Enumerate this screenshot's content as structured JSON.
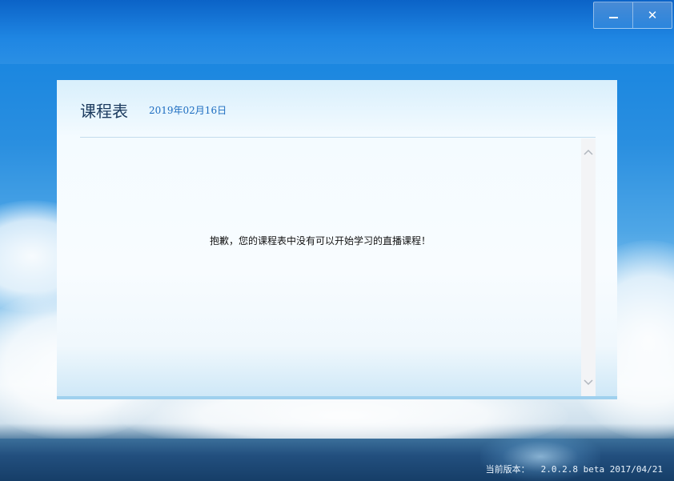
{
  "window": {
    "minimize_label": "–",
    "close_label": "✕"
  },
  "schedule": {
    "title": "课程表",
    "date": "2019年02月16日",
    "empty_message": "抱歉，您的课程表中没有可以开始学习的直播课程！"
  },
  "footer": {
    "version_label": "当前版本：",
    "version_value": "2.0.2.8 beta 2017/04/21"
  },
  "icons": {
    "minimize": "minimize-icon",
    "close": "close-icon",
    "scroll_up": "chevron-up-icon",
    "scroll_down": "chevron-down-icon"
  },
  "colors": {
    "panel_accent": "#9fd0ee",
    "title": "#1b3a5e",
    "date": "#1c6cc0"
  }
}
